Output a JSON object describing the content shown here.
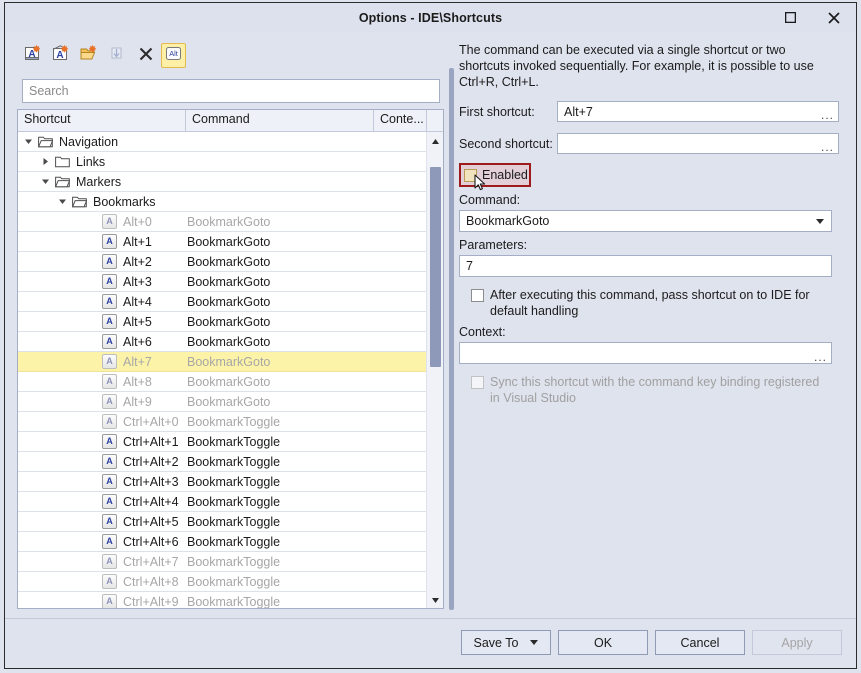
{
  "window": {
    "title": "Options - IDE\\Shortcuts",
    "maximize_tooltip": "Maximize",
    "close_tooltip": "Close"
  },
  "toolbar": {
    "buttons": [
      {
        "name": "add-shortcut-button",
        "icon": "letter-a-add-icon",
        "disabled": false,
        "active": false
      },
      {
        "name": "edit-shortcut-button",
        "icon": "letter-a-edit-icon",
        "disabled": false,
        "active": false
      },
      {
        "name": "open-folder-button",
        "icon": "open-folder-add-icon",
        "disabled": false,
        "active": false
      },
      {
        "name": "import-button",
        "icon": "import-arrow-icon",
        "disabled": true,
        "active": false
      },
      {
        "name": "delete-button",
        "icon": "close-x-icon",
        "disabled": false,
        "active": false
      },
      {
        "name": "alt-filter-toggle",
        "icon": "alt-key-icon",
        "disabled": false,
        "active": true,
        "label": "Alt"
      }
    ]
  },
  "search": {
    "placeholder": "Search",
    "value": ""
  },
  "list": {
    "columns": [
      "Shortcut",
      "Command",
      "Conte..."
    ],
    "rows": [
      {
        "type": "node",
        "depth": 0,
        "expanded": true,
        "label": "Navigation"
      },
      {
        "type": "node",
        "depth": 1,
        "expanded": false,
        "label": "Links"
      },
      {
        "type": "node",
        "depth": 1,
        "expanded": true,
        "label": "Markers"
      },
      {
        "type": "node",
        "depth": 2,
        "expanded": true,
        "label": "Bookmarks"
      },
      {
        "type": "item",
        "shortcut": "Alt+0",
        "command": "BookmarkGoto",
        "context": "",
        "dim": true,
        "selected": false
      },
      {
        "type": "item",
        "shortcut": "Alt+1",
        "command": "BookmarkGoto",
        "context": "",
        "dim": false,
        "selected": false
      },
      {
        "type": "item",
        "shortcut": "Alt+2",
        "command": "BookmarkGoto",
        "context": "",
        "dim": false,
        "selected": false
      },
      {
        "type": "item",
        "shortcut": "Alt+3",
        "command": "BookmarkGoto",
        "context": "",
        "dim": false,
        "selected": false
      },
      {
        "type": "item",
        "shortcut": "Alt+4",
        "command": "BookmarkGoto",
        "context": "",
        "dim": false,
        "selected": false
      },
      {
        "type": "item",
        "shortcut": "Alt+5",
        "command": "BookmarkGoto",
        "context": "",
        "dim": false,
        "selected": false
      },
      {
        "type": "item",
        "shortcut": "Alt+6",
        "command": "BookmarkGoto",
        "context": "",
        "dim": false,
        "selected": false
      },
      {
        "type": "item",
        "shortcut": "Alt+7",
        "command": "BookmarkGoto",
        "context": "",
        "dim": true,
        "selected": true
      },
      {
        "type": "item",
        "shortcut": "Alt+8",
        "command": "BookmarkGoto",
        "context": "",
        "dim": true,
        "selected": false
      },
      {
        "type": "item",
        "shortcut": "Alt+9",
        "command": "BookmarkGoto",
        "context": "",
        "dim": true,
        "selected": false
      },
      {
        "type": "item",
        "shortcut": "Ctrl+Alt+0",
        "command": "BookmarkToggle",
        "context": "",
        "dim": true,
        "selected": false
      },
      {
        "type": "item",
        "shortcut": "Ctrl+Alt+1",
        "command": "BookmarkToggle",
        "context": "",
        "dim": false,
        "selected": false
      },
      {
        "type": "item",
        "shortcut": "Ctrl+Alt+2",
        "command": "BookmarkToggle",
        "context": "",
        "dim": false,
        "selected": false
      },
      {
        "type": "item",
        "shortcut": "Ctrl+Alt+3",
        "command": "BookmarkToggle",
        "context": "",
        "dim": false,
        "selected": false
      },
      {
        "type": "item",
        "shortcut": "Ctrl+Alt+4",
        "command": "BookmarkToggle",
        "context": "",
        "dim": false,
        "selected": false
      },
      {
        "type": "item",
        "shortcut": "Ctrl+Alt+5",
        "command": "BookmarkToggle",
        "context": "",
        "dim": false,
        "selected": false
      },
      {
        "type": "item",
        "shortcut": "Ctrl+Alt+6",
        "command": "BookmarkToggle",
        "context": "",
        "dim": false,
        "selected": false
      },
      {
        "type": "item",
        "shortcut": "Ctrl+Alt+7",
        "command": "BookmarkToggle",
        "context": "",
        "dim": true,
        "selected": false
      },
      {
        "type": "item",
        "shortcut": "Ctrl+Alt+8",
        "command": "BookmarkToggle",
        "context": "",
        "dim": true,
        "selected": false
      },
      {
        "type": "item",
        "shortcut": "Ctrl+Alt+9",
        "command": "BookmarkToggle",
        "context": "",
        "dim": true,
        "selected": false
      }
    ]
  },
  "details": {
    "hint": "The command can be executed via a single shortcut or two shortcuts invoked sequentially. For example, it is possible to use Ctrl+R, Ctrl+L.",
    "first_shortcut_label": "First shortcut:",
    "first_shortcut_value": "Alt+7",
    "second_shortcut_label": "Second shortcut:",
    "second_shortcut_value": "",
    "enabled_label": "Enabled",
    "enabled_checked": false,
    "command_label": "Command:",
    "command_value": "BookmarkGoto",
    "parameters_label": "Parameters:",
    "parameters_value": "7",
    "pass_shortcut_label": "After executing this command, pass shortcut on to IDE for default handling",
    "pass_shortcut_checked": false,
    "context_label": "Context:",
    "context_value": "",
    "sync_label": "Sync this shortcut with the command key binding registered in Visual Studio",
    "sync_checked": false,
    "sync_disabled": true,
    "ellipsis": "..."
  },
  "footer": {
    "save_to_label": "Save To",
    "ok_label": "OK",
    "cancel_label": "Cancel",
    "apply_label": "Apply",
    "apply_disabled": true
  },
  "colors": {
    "dialog_bg": "#dfe3ee",
    "selection_yellow": "#fdf3a8",
    "highlight_red": "#9e1b1b",
    "toggle_yellow": "#fdf0a6",
    "accent_blue": "#2b3fa0",
    "disabled_text": "#a6a6a6"
  }
}
